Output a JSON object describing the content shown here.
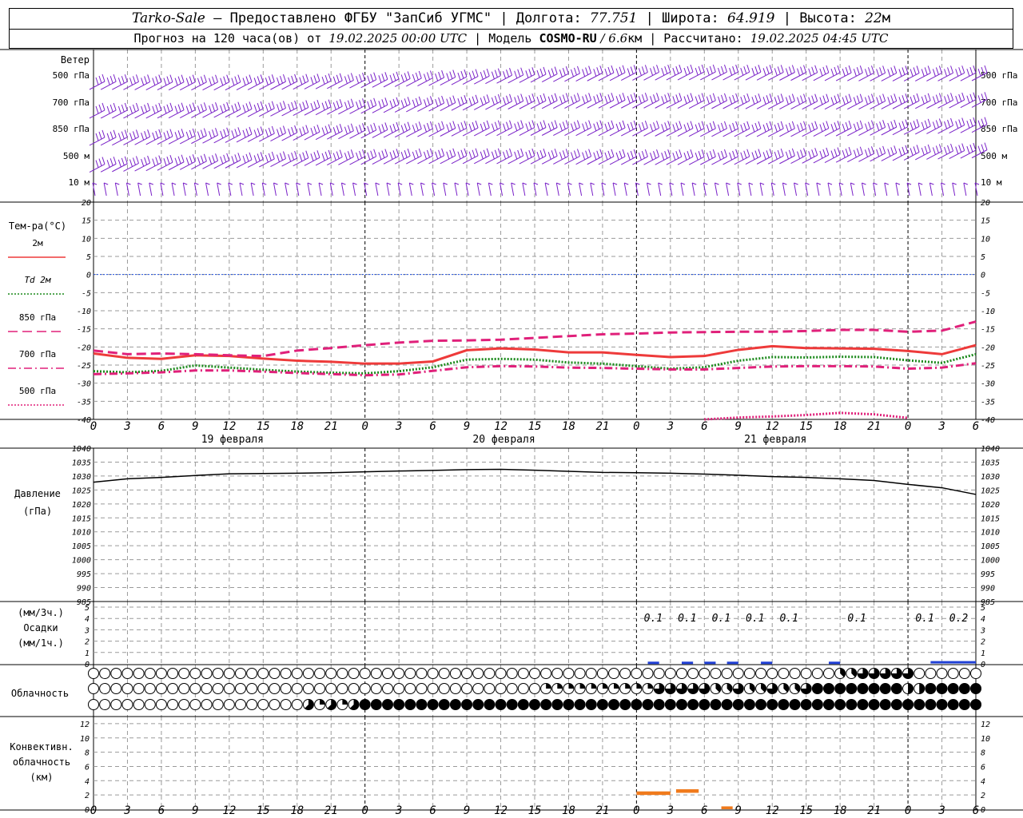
{
  "header": {
    "station": "Tarko-Sale",
    "sep1": " – Предоставлено ФГБУ \"ЗапСиб УГМС\" | Долгота: ",
    "lon": "77.751",
    "sep2": " | Широта: ",
    "lat": "64.919",
    "sep3": " | Высота: ",
    "alt": "22",
    "alt_unit": "м",
    "fc_prefix": "Прогноз на 120 часа(ов) от ",
    "fc_start": "19.02.2025 00:00 UTC",
    "model_prefix": " | Модель ",
    "model": "COSMO-RU",
    "model_res": " / 6.6",
    "res_unit": "км",
    "calc_prefix": " | Рассчитано: ",
    "calc_time": "19.02.2025 04:45 UTC"
  },
  "chart_data": [
    {
      "type": "barbs",
      "title": "Ветер",
      "levels": [
        "500 гПа",
        "700 гПа",
        "850 гПа",
        "500 м",
        "10  м"
      ],
      "color": "#7a22c8"
    },
    {
      "type": "line",
      "title": "Тем-ра(°C)",
      "ylim": [
        -40,
        20
      ],
      "yticks": [
        20,
        15,
        10,
        5,
        0,
        -5,
        -10,
        -15,
        -20,
        -25,
        -30,
        -35,
        -40
      ],
      "x_hours": [
        0,
        3,
        6,
        9,
        12,
        15,
        18,
        21,
        24,
        27,
        30,
        33,
        36,
        39,
        42,
        45,
        48,
        51,
        54,
        57,
        60,
        63,
        66,
        69,
        72,
        75,
        78
      ],
      "series": [
        {
          "name": "2м",
          "color": "#ee3a3a",
          "style": "solid",
          "values": [
            -21.8,
            -23.0,
            -23.3,
            -22.3,
            -22.5,
            -23.2,
            -23.8,
            -24.1,
            -24.6,
            -24.6,
            -24.0,
            -20.9,
            -20.4,
            -20.7,
            -21.5,
            -21.5,
            -22.2,
            -22.8,
            -22.5,
            -20.8,
            -19.8,
            -20.3,
            -20.4,
            -20.5,
            -21.1,
            -22.0,
            -19.5
          ]
        },
        {
          "name": "Td  2м",
          "color": "#1c8a1c",
          "style": "dotted",
          "values": [
            -26.7,
            -27.0,
            -26.6,
            -25.1,
            -25.7,
            -26.3,
            -26.8,
            -27.1,
            -27.3,
            -26.7,
            -25.6,
            -23.5,
            -23.3,
            -23.5,
            -24.3,
            -24.6,
            -25.3,
            -26.0,
            -25.6,
            -23.8,
            -22.8,
            -22.9,
            -22.7,
            -22.8,
            -23.7,
            -24.4,
            -22.0
          ]
        },
        {
          "name": "850 гПа",
          "color": "#e0207a",
          "style": "longdash",
          "values": [
            -21.0,
            -22.0,
            -21.8,
            -22.0,
            -22.3,
            -22.5,
            -21.0,
            -20.3,
            -19.5,
            -18.8,
            -18.3,
            -18.2,
            -18.0,
            -17.5,
            -17.0,
            -16.5,
            -16.3,
            -16.0,
            -15.9,
            -15.8,
            -15.8,
            -15.6,
            -15.3,
            -15.3,
            -15.8,
            -15.5,
            -13.0
          ]
        },
        {
          "name": "700 гПа",
          "color": "#e0207a",
          "style": "dashdot",
          "values": [
            -27.5,
            -27.3,
            -27.0,
            -26.5,
            -26.5,
            -26.8,
            -27.2,
            -27.5,
            -27.8,
            -27.6,
            -26.6,
            -25.6,
            -25.3,
            -25.4,
            -25.7,
            -25.8,
            -26.0,
            -26.2,
            -26.2,
            -25.8,
            -25.4,
            -25.3,
            -25.3,
            -25.4,
            -26.0,
            -25.7,
            -24.5
          ]
        },
        {
          "name": "500 гПа",
          "color": "#e0207a",
          "style": "dotted",
          "x_hours": [
            54,
            57,
            60,
            63,
            66,
            69,
            72
          ],
          "values": [
            -40.0,
            -39.5,
            -39.2,
            -38.8,
            -38.2,
            -38.6,
            -39.6
          ]
        }
      ]
    },
    {
      "type": "line",
      "title": "Давление",
      "unit": "(гПа)",
      "ylim": [
        985,
        1040
      ],
      "yticks": [
        1040,
        1035,
        1030,
        1025,
        1020,
        1015,
        1010,
        1005,
        1000,
        995,
        990,
        985
      ],
      "x_hours": [
        0,
        3,
        6,
        9,
        12,
        15,
        18,
        21,
        24,
        27,
        30,
        33,
        36,
        39,
        42,
        45,
        48,
        51,
        54,
        57,
        60,
        63,
        66,
        69,
        72,
        75,
        78
      ],
      "series": [
        {
          "name": "Давление",
          "color": "#000000",
          "values": [
            1027.8,
            1029.0,
            1029.5,
            1030.2,
            1030.8,
            1030.9,
            1031.0,
            1031.2,
            1031.5,
            1031.8,
            1032.0,
            1032.3,
            1032.4,
            1032.1,
            1031.7,
            1031.3,
            1031.2,
            1031.0,
            1030.7,
            1030.3,
            1029.8,
            1029.5,
            1029.0,
            1028.4,
            1027.0,
            1025.8,
            1023.4
          ]
        }
      ]
    },
    {
      "type": "bar",
      "title": "Осадки",
      "units_top": "(мм/3ч.)",
      "units_bottom": "(мм/1ч.)",
      "ylim": [
        0,
        5
      ],
      "yticks": [
        5,
        4,
        3,
        2,
        1,
        0
      ],
      "labels": [
        {
          "x_hour": 48,
          "text": "0.1"
        },
        {
          "x_hour": 51,
          "text": "0.1"
        },
        {
          "x_hour": 54,
          "text": "0.1"
        },
        {
          "x_hour": 57,
          "text": "0.1"
        },
        {
          "x_hour": 60,
          "text": "0.1"
        },
        {
          "x_hour": 66,
          "text": "0.1"
        },
        {
          "x_hour": 72,
          "text": "0.1"
        },
        {
          "x_hour": 75,
          "text": "0.2"
        }
      ],
      "color": "#1f3fd6",
      "bars": [
        {
          "from": 49.0,
          "to": 50.0,
          "value": 0.05
        },
        {
          "from": 52.0,
          "to": 53.0,
          "value": 0.05
        },
        {
          "from": 54.0,
          "to": 55.0,
          "value": 0.05
        },
        {
          "from": 56.0,
          "to": 57.0,
          "value": 0.05
        },
        {
          "from": 59.0,
          "to": 60.0,
          "value": 0.05
        },
        {
          "from": 65.0,
          "to": 66.0,
          "value": 0.05
        },
        {
          "from": 74.0,
          "to": 78.0,
          "value": 0.1
        }
      ]
    },
    {
      "type": "symbols",
      "title": "Облачность",
      "rows": 3,
      "note": "cloud cover oktas per row per hour 0..78"
    },
    {
      "type": "bar",
      "title": "Конвективн. облачность",
      "unit": "(км)",
      "ylim": [
        0,
        13
      ],
      "yticks": [
        12,
        10,
        8,
        6,
        4,
        2,
        0
      ],
      "color": "#f07a1c",
      "segments": [
        {
          "from": 48,
          "to": 51,
          "bottom": 2.0,
          "top": 2.5
        },
        {
          "from": 51.5,
          "to": 53.5,
          "bottom": 2.3,
          "top": 2.8
        },
        {
          "from": 55.5,
          "to": 56.5,
          "bottom": 0.0,
          "top": 0.4
        }
      ]
    }
  ],
  "x_axis": {
    "tick_labels": [
      "0",
      "3",
      "6",
      "9",
      "12",
      "15",
      "18",
      "21",
      "0",
      "3",
      "6",
      "9",
      "12",
      "15",
      "18",
      "21",
      "0",
      "3",
      "6",
      "9",
      "12",
      "15",
      "18",
      "21",
      "0",
      "3",
      "6"
    ],
    "day_labels": [
      {
        "x_hour": 12,
        "text": "19 февраля"
      },
      {
        "x_hour": 36,
        "text": "20 февраля"
      },
      {
        "x_hour": 60,
        "text": "21 февраля"
      }
    ]
  },
  "cloud_rows": {
    "top": "000000000000000000000000000000000000000000000000000000000000000000000000000000000000000000000000000000000000000000000000000000000000000000000000000000000000000000000000000000000000000000000000",
    "middle": "",
    "bottom": ""
  },
  "colors": {
    "grid": "#9a9a9a",
    "wind": "#7a22c8",
    "zero_line": "#2050e0"
  }
}
